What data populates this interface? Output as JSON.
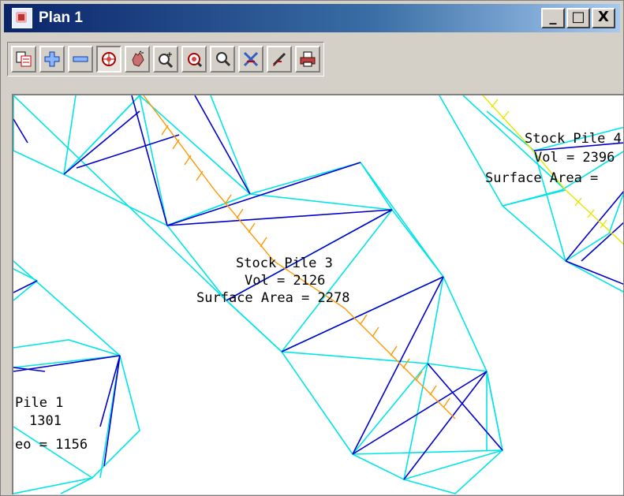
{
  "window": {
    "title": "Plan 1",
    "controls": {
      "minimize": "_",
      "maximize": "□",
      "close": "X"
    }
  },
  "toolbar": {
    "buttons": [
      {
        "icon": "plot-frame-icon",
        "pressed": false
      },
      {
        "icon": "zoom-in-plus-icon",
        "pressed": false
      },
      {
        "icon": "zoom-out-minus-icon",
        "pressed": false
      },
      {
        "icon": "zoom-extents-icon",
        "pressed": true
      },
      {
        "icon": "pan-hand-icon",
        "pressed": false
      },
      {
        "icon": "zoom-window-icon",
        "pressed": false
      },
      {
        "icon": "zoom-center-icon",
        "pressed": false
      },
      {
        "icon": "zoom-previous-icon",
        "pressed": false
      },
      {
        "icon": "clear-cross-icon",
        "pressed": false
      },
      {
        "icon": "pick-pen-icon",
        "pressed": false
      },
      {
        "icon": "print-icon",
        "pressed": false
      }
    ]
  },
  "plan": {
    "colors": {
      "triangle_edge": "#00e5e5",
      "triangle_diag": "#0000cc",
      "breakline": "#ff9900",
      "breakline_alt": "#e6e600",
      "text": "#000000"
    },
    "labels": {
      "pile3_name": "Stock Pile 3",
      "pile3_vol": "Vol = 2126",
      "pile3_area": "Surface Area = 2278",
      "pile1_name": "Pile 1",
      "pile1_vol": "1301",
      "pile1_area": "eo = 1156",
      "pile_right_name": "Stock Pile 4",
      "pile_right_vol": "Vol = 2396",
      "pile_right_area": "Surface Area ="
    }
  }
}
